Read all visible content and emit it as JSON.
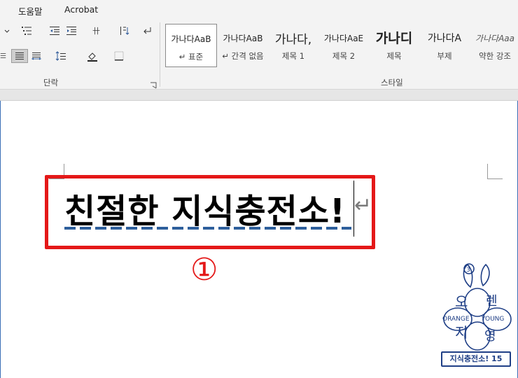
{
  "tabs": {
    "help": "도움말",
    "acrobat": "Acrobat"
  },
  "paragraph_group": {
    "label": "단락"
  },
  "styles_group": {
    "label": "스타일",
    "items": [
      {
        "sample": "가나다AaB",
        "name": "↵ 표준",
        "selected": true
      },
      {
        "sample": "가나다AaB",
        "name": "↵ 간격 없음",
        "selected": false
      },
      {
        "sample": "가나다,",
        "name": "제목 1",
        "selected": false
      },
      {
        "sample": "가나다AaE",
        "name": "제목 2",
        "selected": false
      },
      {
        "sample": "가나디",
        "name": "제목",
        "selected": false
      },
      {
        "sample": "가나다A",
        "name": "부제",
        "selected": false
      },
      {
        "sample": "가나다Aaa",
        "name": "약한 강조",
        "selected": false
      }
    ]
  },
  "document": {
    "headline": "친절한 지식충전소!",
    "return_mark": "↵",
    "marker": "①"
  },
  "logo": {
    "top_chars": [
      "오",
      "렌"
    ],
    "bottom_chars": [
      "지",
      "영"
    ],
    "left_word": "ORANGE",
    "right_word": "YOUNG",
    "badge": "지식충전소! 15"
  },
  "colors": {
    "highlight": "#e41818",
    "logo_blue": "#1f3f86",
    "squiggle": "#2e5f9c"
  }
}
